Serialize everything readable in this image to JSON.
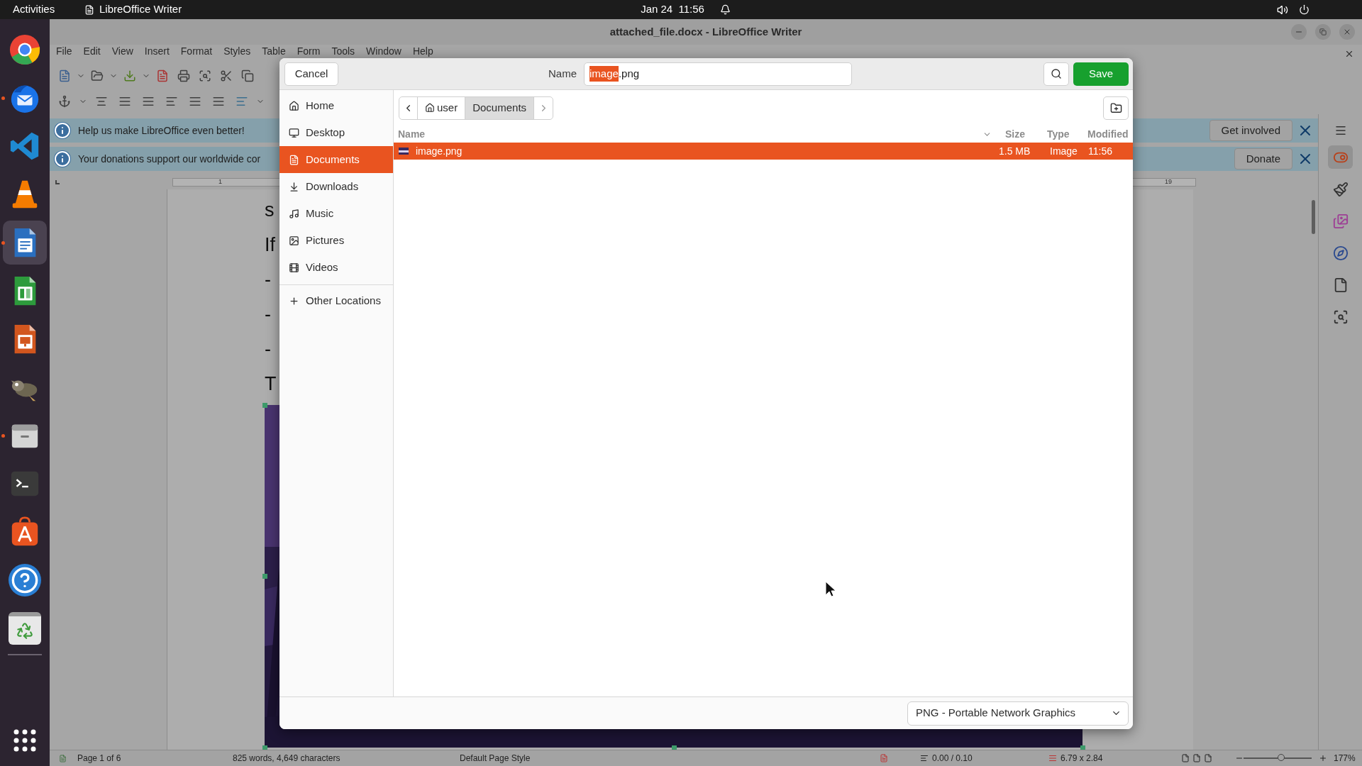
{
  "top_bar": {
    "activities": "Activities",
    "app": "LibreOffice Writer",
    "clock": "Jan 24  11:56"
  },
  "dock": [
    {
      "kind": "chrome",
      "running": false,
      "selected": false
    },
    {
      "kind": "thunderbird",
      "running": true,
      "selected": false
    },
    {
      "kind": "vscode",
      "running": false,
      "selected": false
    },
    {
      "kind": "vlc",
      "running": false,
      "selected": false
    },
    {
      "kind": "writer",
      "running": true,
      "selected": true
    },
    {
      "kind": "calc",
      "running": false,
      "selected": false
    },
    {
      "kind": "impress",
      "running": false,
      "selected": false
    },
    {
      "kind": "gimp",
      "running": false,
      "selected": false
    },
    {
      "kind": "files",
      "running": true,
      "selected": false
    },
    {
      "kind": "terminal",
      "running": false,
      "selected": false
    },
    {
      "kind": "appcenter",
      "running": false,
      "selected": false
    },
    {
      "kind": "help",
      "running": false,
      "selected": false
    },
    {
      "kind": "trash",
      "running": false,
      "selected": false
    }
  ],
  "window": {
    "title": "attached_file.docx - LibreOffice Writer"
  },
  "menu": [
    "File",
    "Edit",
    "View",
    "Insert",
    "Format",
    "Styles",
    "Table",
    "Form",
    "Tools",
    "Window",
    "Help"
  ],
  "infobars": [
    {
      "text": "Help us make LibreOffice even better!",
      "button": "Get involved"
    },
    {
      "text": "Your donations support our worldwide cor",
      "button": "Donate"
    }
  ],
  "ruler": {
    "marks": [
      "1",
      "19"
    ]
  },
  "document": {
    "lines": [
      "s",
      "If",
      "-",
      "-",
      "-",
      "T"
    ]
  },
  "sidebar_deck": [
    {
      "kind": "properties",
      "selected": true
    },
    {
      "kind": "styles",
      "selected": false
    },
    {
      "kind": "gallery",
      "selected": false
    },
    {
      "kind": "navigator",
      "selected": false
    },
    {
      "kind": "page",
      "selected": false
    },
    {
      "kind": "find",
      "selected": false
    }
  ],
  "status_bar": {
    "page": "Page 1 of 6",
    "words": "825 words, 4,649 characters",
    "page_style": "Default Page Style",
    "position": "0.00 / 0.10",
    "size": "6.79 x 2.84",
    "zoom_slider": {
      "level": 0.55
    },
    "zoom": "177%"
  },
  "save_dialog": {
    "cancel": "Cancel",
    "name_label": "Name",
    "filename": [
      {
        "text": "image",
        "selected": true
      },
      {
        "text": ".png",
        "selected": false
      }
    ],
    "save": "Save",
    "places": [
      {
        "kind": "home",
        "label": "Home",
        "selected": false
      },
      {
        "kind": "desktop",
        "label": "Desktop",
        "selected": false
      },
      {
        "kind": "documents",
        "label": "Documents",
        "selected": true
      },
      {
        "kind": "downloads",
        "label": "Downloads",
        "selected": false
      },
      {
        "kind": "music",
        "label": "Music",
        "selected": false
      },
      {
        "kind": "pictures",
        "label": "Pictures",
        "selected": false
      },
      {
        "kind": "videos",
        "label": "Videos",
        "selected": false
      }
    ],
    "other_locations": "Other Locations",
    "path": [
      {
        "kind": "home",
        "label": "user",
        "selected": false
      },
      {
        "kind": "folder",
        "label": "Documents",
        "selected": true
      }
    ],
    "columns": [
      "Name",
      "Size",
      "Type",
      "Modified"
    ],
    "files": [
      {
        "name": "image.png",
        "size": "1.5 MB",
        "type": "Image",
        "modified": "11:56",
        "selected": true
      }
    ],
    "file_type": "PNG - Portable Network Graphics"
  }
}
